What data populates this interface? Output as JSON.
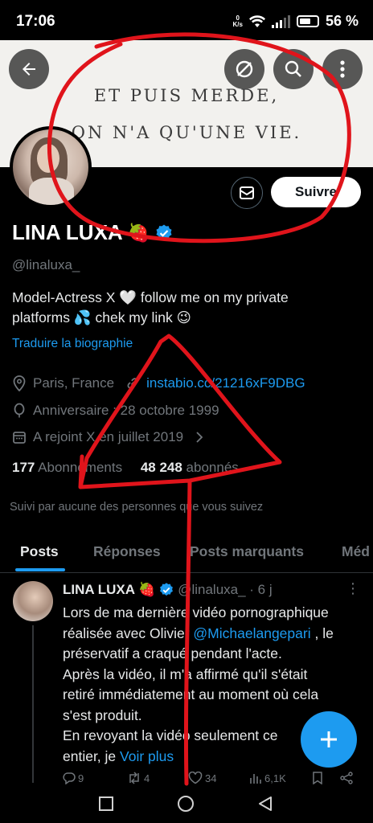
{
  "status_bar": {
    "time": "17:06",
    "network_speed": "0\nK/s",
    "battery": "56 %"
  },
  "banner": {
    "line1": "ET PUIS MERDE,",
    "line2": "ON N'A QU'UNE VIE."
  },
  "header_buttons": {
    "back_icon": "arrow-left-icon",
    "hide_icon": "eye-slash-icon",
    "search_icon": "search-icon",
    "more_icon": "more-vertical-icon"
  },
  "profile": {
    "display_name": "LINA LUXA",
    "name_emoji": "🍓",
    "handle": "@linaluxa_",
    "bio_line1": "Model-Actress X  🤍 follow me on my private",
    "bio_line2": "platforms 💦 chek my link 😉",
    "translate": "Traduire la biographie",
    "location": "Paris, France",
    "link": "instabio.cc/21216xF9DBG",
    "birthday": "Anniversaire : 28 octobre 1999",
    "joined": "A rejoint X en juillet 2019",
    "following_count": "177",
    "following_label": "Abonnements",
    "followers_count": "48 248",
    "followers_label": "abonnés",
    "followed_by": "Suivi par aucune des personnes que vous suivez",
    "follow_button": "Suivre"
  },
  "tabs": [
    {
      "label": "Posts",
      "active": true
    },
    {
      "label": "Réponses",
      "active": false
    },
    {
      "label": "Posts marquants",
      "active": false
    },
    {
      "label": "Méd",
      "active": false
    }
  ],
  "post": {
    "author": "LINA LUXA",
    "author_emoji": "🍓",
    "handle_time": "@linaluxa_ · 6 j",
    "line1": "Lors de ma dernière  vidéo pornographique",
    "line2_prefix": "réalisée avec Olivier ",
    "mention": "@Michaelangepari",
    "line2_suffix": " , le",
    "line3": "préservatif a craqué pendant l'acte.",
    "line4": "Après la vidéo, il m'a affirmé qu'il s'était",
    "line5": "retiré immédiatement au moment où cela",
    "line6": "s'est produit.",
    "line7": "En revoyant  la vidéo seulement ce",
    "line8_prefix": "entier, je ",
    "see_more": "Voir plus",
    "replies": "9",
    "reposts": "4",
    "likes": "34",
    "views": "6,1K"
  },
  "colors": {
    "accent": "#1d9bf0",
    "annotation": "#e0141b",
    "background": "#000000"
  }
}
